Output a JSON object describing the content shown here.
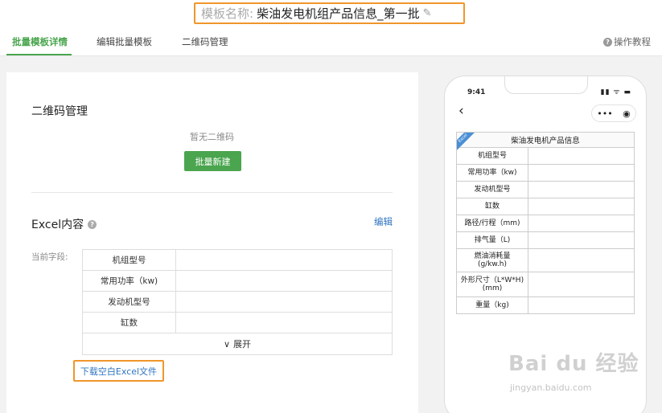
{
  "header": {
    "title_label": "模板名称:",
    "title_value": "柴油发电机组产品信息_第一批"
  },
  "tabs": [
    {
      "label": "批量模板详情",
      "active": true
    },
    {
      "label": "编辑批量模板",
      "active": false
    },
    {
      "label": "二维码管理",
      "active": false
    }
  ],
  "help": {
    "label": "操作教程"
  },
  "qr_section": {
    "title": "二维码管理",
    "empty_text": "暂无二维码",
    "button_label": "批量新建"
  },
  "excel_section": {
    "title": "Excel内容",
    "edit_label": "编辑",
    "current_fields_label": "当前字段:",
    "fields": [
      "机组型号",
      "常用功率（kw)",
      "发动机型号",
      "缸数"
    ],
    "expand_label": "展开",
    "download_label": "下载空白Excel文件"
  },
  "phone": {
    "time": "9:41",
    "table_title": "柴油发电机产品信息",
    "ribbon": "Excel",
    "rows": [
      "机组型号",
      "常用功率（kw)",
      "发动机型号",
      "缸数",
      "路径/行程（mm)",
      "排气量（L)",
      "燃油消耗量\n(g/kw.h)",
      "外形尺寸（L*W*H)\n(mm)",
      "重量（kg)"
    ]
  },
  "watermark": {
    "main": "Bai du 经验",
    "sub": "jingyan.baidu.com"
  },
  "colors": {
    "accent_green": "#4aa54e",
    "highlight_orange": "#f0962a",
    "link_blue": "#2e74c0"
  }
}
